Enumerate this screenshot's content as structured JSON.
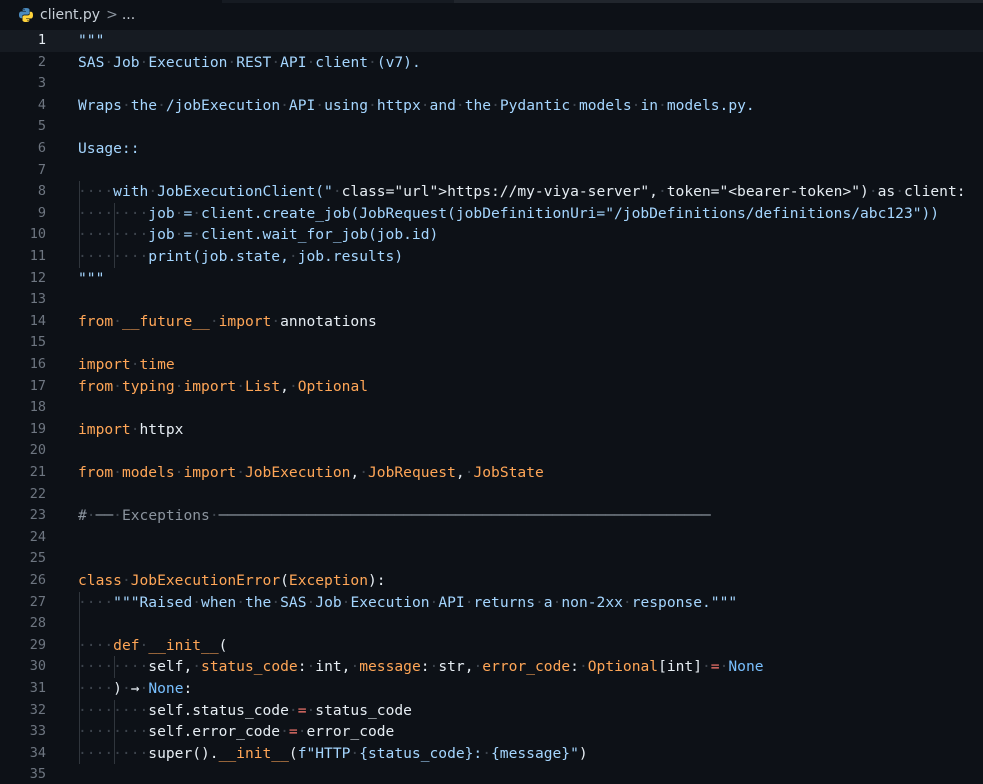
{
  "breadcrumb": {
    "file": "client.py",
    "separator": ">",
    "ellipsis": "..."
  },
  "editor": {
    "current_line": 1,
    "lines": [
      {
        "n": "1",
        "t": "\"\"\""
      },
      {
        "n": "2",
        "t": "SAS Job Execution REST API client (v7)."
      },
      {
        "n": "3",
        "t": ""
      },
      {
        "n": "4",
        "t": "Wraps the /jobExecution API using httpx and the Pydantic models in models.py."
      },
      {
        "n": "5",
        "t": ""
      },
      {
        "n": "6",
        "t": "Usage::"
      },
      {
        "n": "7",
        "t": ""
      },
      {
        "n": "8",
        "t": "    with JobExecutionClient(\"https://my-viya-server\", token=\"<bearer-token>\") as client:"
      },
      {
        "n": "9",
        "t": "        job = client.create_job(JobRequest(jobDefinitionUri=\"/jobDefinitions/definitions/abc123\"))"
      },
      {
        "n": "10",
        "t": "        job = client.wait_for_job(job.id)"
      },
      {
        "n": "11",
        "t": "        print(job.state, job.results)"
      },
      {
        "n": "12",
        "t": "\"\"\""
      },
      {
        "n": "13",
        "t": ""
      },
      {
        "n": "14",
        "t": "from __future__ import annotations"
      },
      {
        "n": "15",
        "t": ""
      },
      {
        "n": "16",
        "t": "import time"
      },
      {
        "n": "17",
        "t": "from typing import List, Optional"
      },
      {
        "n": "18",
        "t": ""
      },
      {
        "n": "19",
        "t": "import httpx"
      },
      {
        "n": "20",
        "t": ""
      },
      {
        "n": "21",
        "t": "from models import JobExecution, JobRequest, JobState"
      },
      {
        "n": "22",
        "t": ""
      },
      {
        "n": "23",
        "t": "# ── Exceptions ────────────────────────────────────────────────────────"
      },
      {
        "n": "24",
        "t": ""
      },
      {
        "n": "25",
        "t": ""
      },
      {
        "n": "26",
        "t": "class JobExecutionError(Exception):"
      },
      {
        "n": "27",
        "t": "    \"\"\"Raised when the SAS Job Execution API returns a non-2xx response.\"\"\""
      },
      {
        "n": "28",
        "t": ""
      },
      {
        "n": "29",
        "t": "    def __init__("
      },
      {
        "n": "30",
        "t": "        self, status_code: int, message: str, error_code: Optional[int] = None"
      },
      {
        "n": "31",
        "t": "    ) → None:"
      },
      {
        "n": "32",
        "t": "        self.status_code = status_code"
      },
      {
        "n": "33",
        "t": "        self.error_code = error_code"
      },
      {
        "n": "34",
        "t": "        super().__init__(f\"HTTP {status_code}: {message}\")"
      },
      {
        "n": "35",
        "t": ""
      }
    ]
  },
  "colors": {
    "background": "#0d1117",
    "string": "#a5d6ff",
    "keyword": "#ff7b72",
    "import_keyword": "#ffa657",
    "function": "#d2a8ff",
    "constant": "#79c0ff",
    "comment": "#8b949e"
  }
}
